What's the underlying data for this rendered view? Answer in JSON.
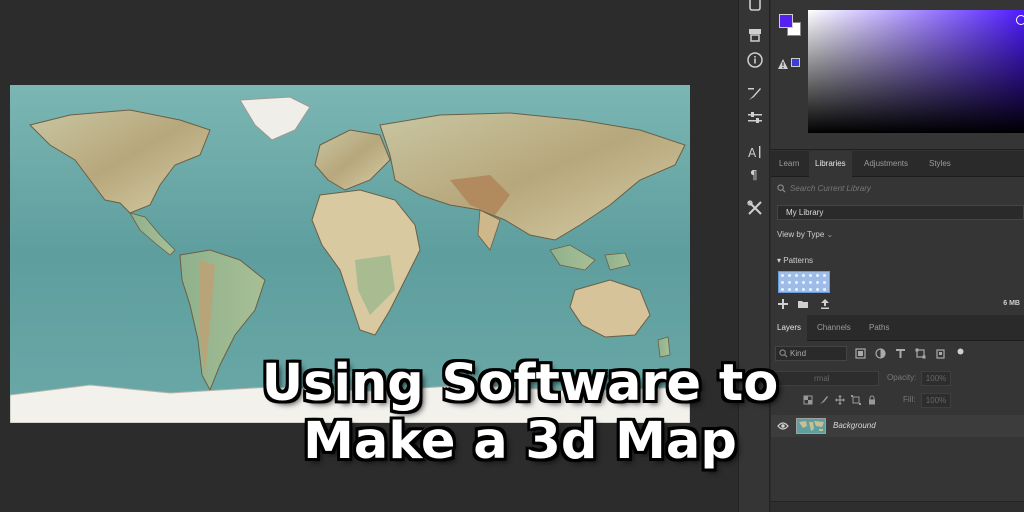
{
  "toolbar": {
    "tools": [
      "phone-icon",
      "stamp-icon",
      "info-icon",
      "brush-settings-icon",
      "sliders-icon",
      "character-icon",
      "paragraph-icon",
      "tools-icon"
    ]
  },
  "color_picker": {
    "foreground": "#5421ef",
    "background": "#ffffff",
    "hue": "#4f1bff"
  },
  "panel_tabs_top": [
    {
      "label": "Learn",
      "active": false
    },
    {
      "label": "Libraries",
      "active": true
    },
    {
      "label": "Adjustments",
      "active": false
    },
    {
      "label": "Styles",
      "active": false
    }
  ],
  "libraries": {
    "search_placeholder": "Search Current Library",
    "library_name": "My Library",
    "view_by": "View by Type",
    "section": "Patterns",
    "size": "6 MB"
  },
  "panel_tabs_bottom": [
    {
      "label": "Layers",
      "active": true
    },
    {
      "label": "Channels",
      "active": false
    },
    {
      "label": "Paths",
      "active": false
    }
  ],
  "layers": {
    "kind": "Kind",
    "blend_mode": "rmal",
    "opacity_label": "Opacity:",
    "opacity_value": "100%",
    "fill_label": "Fill:",
    "fill_value": "100%",
    "items": [
      {
        "name": "Background",
        "visible": true
      }
    ]
  },
  "caption": {
    "line1": "Using Software to",
    "line2": "Make a 3d Map"
  }
}
